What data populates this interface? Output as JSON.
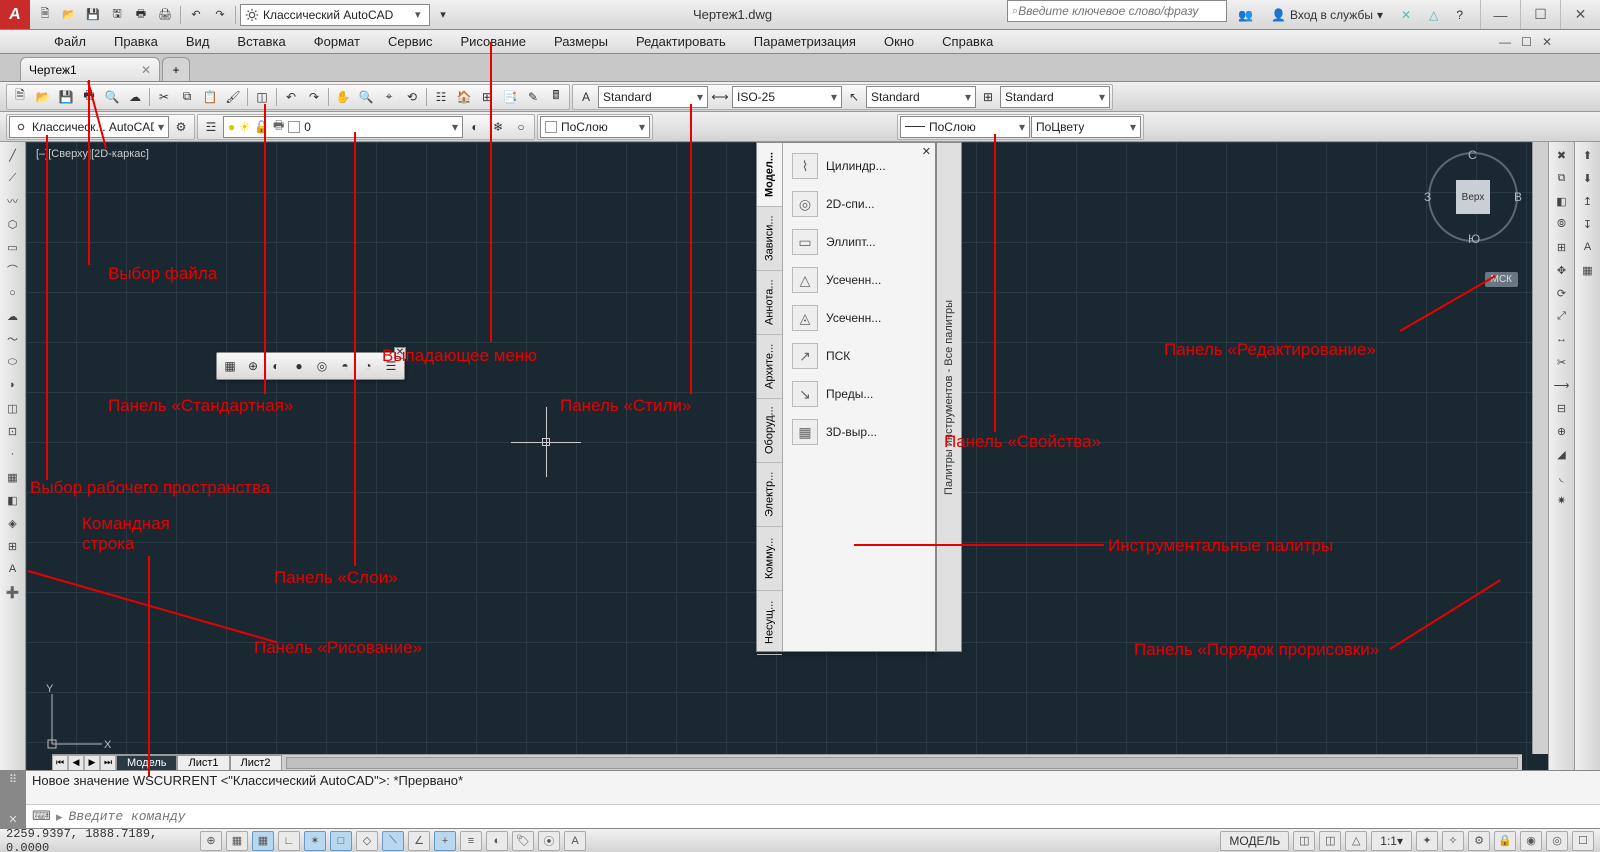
{
  "app": {
    "letter": "A",
    "doc_title": "Чертеж1.dwg",
    "workspace": "Классический AutoCAD"
  },
  "search": {
    "placeholder": "Введите ключевое слово/фразу"
  },
  "signin": {
    "label": "Вход в службы"
  },
  "menu": [
    "Файл",
    "Правка",
    "Вид",
    "Вставка",
    "Формат",
    "Сервис",
    "Рисование",
    "Размеры",
    "Редактировать",
    "Параметризация",
    "Окно",
    "Справка"
  ],
  "doc_tab": {
    "label": "Чертеж1"
  },
  "row2": {
    "workspace_combo": "Классическ... AutoCAD",
    "layer_combo": "0",
    "bylayer": "ПоСлою",
    "linetype": "ПоСлою",
    "color": "ПоЦвету"
  },
  "styles": {
    "text": "Standard",
    "dim": "ISO-25",
    "mleader": "Standard",
    "table": "Standard"
  },
  "palette": {
    "title": "Палитры инструментов - Все палитры",
    "tabs": [
      "Модел...",
      "Зависи...",
      "Аннота...",
      "Архите...",
      "Оборуд...",
      "Электр...",
      "Комму...",
      "Несущ..."
    ],
    "items": [
      {
        "icon": "⌇",
        "label": "Цилиндр..."
      },
      {
        "icon": "◎",
        "label": "2D-спи..."
      },
      {
        "icon": "▭",
        "label": "Эллипт..."
      },
      {
        "icon": "△",
        "label": "Усеченн..."
      },
      {
        "icon": "◬",
        "label": "Усеченн..."
      },
      {
        "icon": "↗",
        "label": "ПСК"
      },
      {
        "icon": "↘",
        "label": "Преды..."
      },
      {
        "icon": "▦",
        "label": "3D-выр..."
      }
    ]
  },
  "viewcube": {
    "top": "Верх",
    "n": "С",
    "s": "Ю",
    "e": "В",
    "w": "З",
    "wcs": "МСК"
  },
  "view_label": "[–][Сверху][2D-каркас]",
  "sheets": {
    "model": "Модель",
    "l1": "Лист1",
    "l2": "Лист2"
  },
  "cmd": {
    "history": "Новое значение WSCURRENT <\"Классический AutoCAD\">: *Прервано*",
    "placeholder": "Введите команду"
  },
  "status": {
    "coords": "2259.9397, 1888.7189, 0.0000",
    "model": "МОДЕЛЬ",
    "scale": "1:1"
  },
  "annotations": {
    "file_select": "Выбор файла",
    "dropdown_menu": "Выпадающее меню",
    "panel_standard": "Панель «Стандартная»",
    "panel_styles": "Панель «Стили»",
    "workspace_select": "Выбор рабочего пространства",
    "cmd_line": "Командная\nстрока",
    "panel_layers": "Панель «Слои»",
    "panel_draw": "Панель «Рисование»",
    "panel_edit": "Панель «Редактирование»",
    "panel_props": "Панель «Свойства»",
    "tool_palettes": "Инструментальные палитры",
    "panel_draworder": "Панель «Порядок прорисовки»"
  }
}
